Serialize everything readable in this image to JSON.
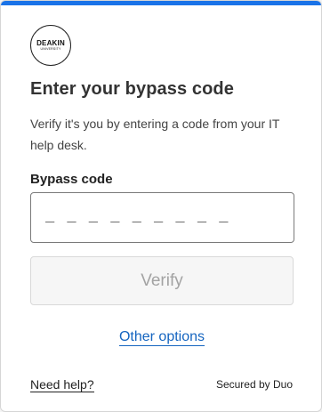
{
  "logo": {
    "name": "DEAKIN",
    "subtitle": "UNIVERSITY"
  },
  "title": "Enter your bypass code",
  "description": "Verify it's you by entering a code from your IT help desk.",
  "field": {
    "label": "Bypass code",
    "placeholder": "_ _ _ _ _ _ _ _ _",
    "value": ""
  },
  "verify_label": "Verify",
  "other_options_label": "Other options",
  "footer": {
    "help_label": "Need help?",
    "secured_label": "Secured by Duo"
  },
  "colors": {
    "accent": "#1a73e8",
    "link": "#1565c0",
    "button_disabled_bg": "#f6f6f6",
    "button_disabled_text": "#a3a3a3"
  }
}
